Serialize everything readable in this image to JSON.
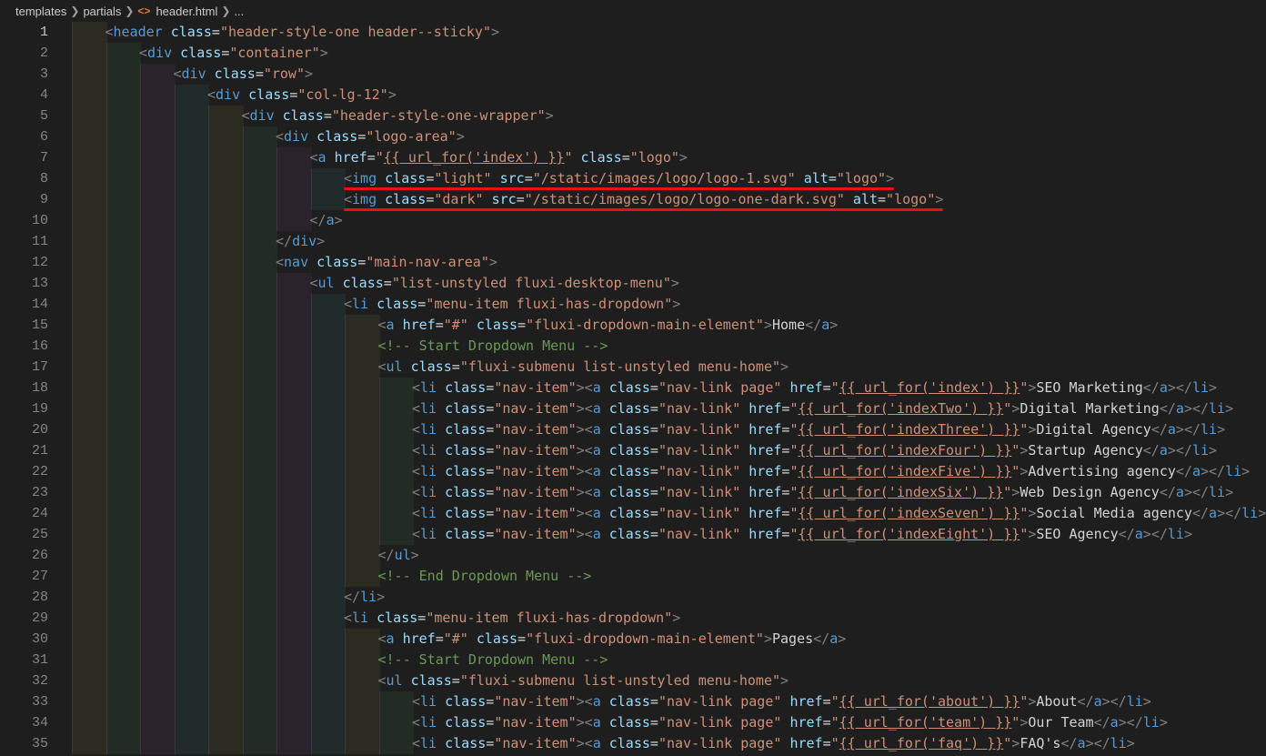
{
  "breadcrumb": {
    "items": [
      "templates",
      "partials",
      "header.html",
      "..."
    ],
    "file_icon": "<>"
  },
  "active_line": 1,
  "lines": [
    {
      "n": "1",
      "indent": 1,
      "code": "<header class=\"header-style-one header--sticky\">"
    },
    {
      "n": "2",
      "indent": 2,
      "code": "<div class=\"container\">"
    },
    {
      "n": "3",
      "indent": 3,
      "code": "<div class=\"row\">"
    },
    {
      "n": "4",
      "indent": 4,
      "code": "<div class=\"col-lg-12\">"
    },
    {
      "n": "5",
      "indent": 5,
      "code": "<div class=\"header-style-one-wrapper\">"
    },
    {
      "n": "6",
      "indent": 6,
      "code": "<div class=\"logo-area\">"
    },
    {
      "n": "7",
      "indent": 7,
      "code": "<a href=\"{{ url_for('index') }}\" class=\"logo\">"
    },
    {
      "n": "8",
      "indent": 8,
      "code": "<img class=\"light\" src=\"/static/images/logo/logo-1.svg\" alt=\"logo\">"
    },
    {
      "n": "9",
      "indent": 8,
      "code": "<img class=\"dark\" src=\"/static/images/logo/logo-one-dark.svg\" alt=\"logo\">"
    },
    {
      "n": "10",
      "indent": 7,
      "code": "</a>"
    },
    {
      "n": "11",
      "indent": 6,
      "code": "</div>"
    },
    {
      "n": "12",
      "indent": 6,
      "code": "<nav class=\"main-nav-area\">"
    },
    {
      "n": "13",
      "indent": 7,
      "code": "<ul class=\"list-unstyled fluxi-desktop-menu\">"
    },
    {
      "n": "14",
      "indent": 8,
      "code": "<li class=\"menu-item fluxi-has-dropdown\">"
    },
    {
      "n": "15",
      "indent": 9,
      "code": "<a href=\"#\" class=\"fluxi-dropdown-main-element\">Home</a>"
    },
    {
      "n": "16",
      "indent": 9,
      "code": "<!-- Start Dropdown Menu -->"
    },
    {
      "n": "17",
      "indent": 9,
      "code": "<ul class=\"fluxi-submenu list-unstyled menu-home\">"
    },
    {
      "n": "18",
      "indent": 10,
      "code": "<li class=\"nav-item\"><a class=\"nav-link page\" href=\"{{ url_for('index') }}\">SEO Marketing</a></li>"
    },
    {
      "n": "19",
      "indent": 10,
      "code": "<li class=\"nav-item\"><a class=\"nav-link\" href=\"{{ url_for('indexTwo') }}\">Digital Marketing</a></li>"
    },
    {
      "n": "20",
      "indent": 10,
      "code": "<li class=\"nav-item\"><a class=\"nav-link\" href=\"{{ url_for('indexThree') }}\">Digital Agency</a></li>"
    },
    {
      "n": "21",
      "indent": 10,
      "code": "<li class=\"nav-item\"><a class=\"nav-link\" href=\"{{ url_for('indexFour') }}\">Startup Agency</a></li>"
    },
    {
      "n": "22",
      "indent": 10,
      "code": "<li class=\"nav-item\"><a class=\"nav-link\" href=\"{{ url_for('indexFive') }}\">Advertising agency</a></li>"
    },
    {
      "n": "23",
      "indent": 10,
      "code": "<li class=\"nav-item\"><a class=\"nav-link\" href=\"{{ url_for('indexSix') }}\">Web Design Agency</a></li>"
    },
    {
      "n": "24",
      "indent": 10,
      "code": "<li class=\"nav-item\"><a class=\"nav-link\" href=\"{{ url_for('indexSeven') }}\">Social Media agency</a></li>"
    },
    {
      "n": "25",
      "indent": 10,
      "code": "<li class=\"nav-item\"><a class=\"nav-link\" href=\"{{ url_for('indexEight') }}\">SEO Agency</a></li>"
    },
    {
      "n": "26",
      "indent": 9,
      "code": "</ul>"
    },
    {
      "n": "27",
      "indent": 9,
      "code": "<!-- End Dropdown Menu -->"
    },
    {
      "n": "28",
      "indent": 8,
      "code": "</li>"
    },
    {
      "n": "29",
      "indent": 8,
      "code": "<li class=\"menu-item fluxi-has-dropdown\">"
    },
    {
      "n": "30",
      "indent": 9,
      "code": "<a href=\"#\" class=\"fluxi-dropdown-main-element\">Pages</a>"
    },
    {
      "n": "31",
      "indent": 9,
      "code": "<!-- Start Dropdown Menu -->"
    },
    {
      "n": "32",
      "indent": 9,
      "code": "<ul class=\"fluxi-submenu list-unstyled menu-home\">"
    },
    {
      "n": "33",
      "indent": 10,
      "code": "<li class=\"nav-item\"><a class=\"nav-link page\" href=\"{{ url_for('about') }}\">About</a></li>"
    },
    {
      "n": "34",
      "indent": 10,
      "code": "<li class=\"nav-item\"><a class=\"nav-link page\" href=\"{{ url_for('team') }}\">Our Team</a></li>"
    },
    {
      "n": "35",
      "indent": 10,
      "code": "<li class=\"nav-item\"><a class=\"nav-link page\" href=\"{{ url_for('faq') }}\">FAQ's</a></li>"
    }
  ],
  "annotated_lines": [
    "8",
    "9"
  ],
  "colors": {
    "background": "#1e1e1e",
    "tag": "#569cd6",
    "attribute": "#9cdcfe",
    "string": "#ce9178",
    "comment": "#6a9955",
    "annotation": "#e51414",
    "indent_guides": [
      "#2b2b22",
      "#232b25",
      "#2b232b",
      "#222b2b",
      "#2b2b22",
      "#232b25",
      "#2b232b",
      "#222b2b",
      "#2b2b22",
      "#232b25"
    ]
  }
}
